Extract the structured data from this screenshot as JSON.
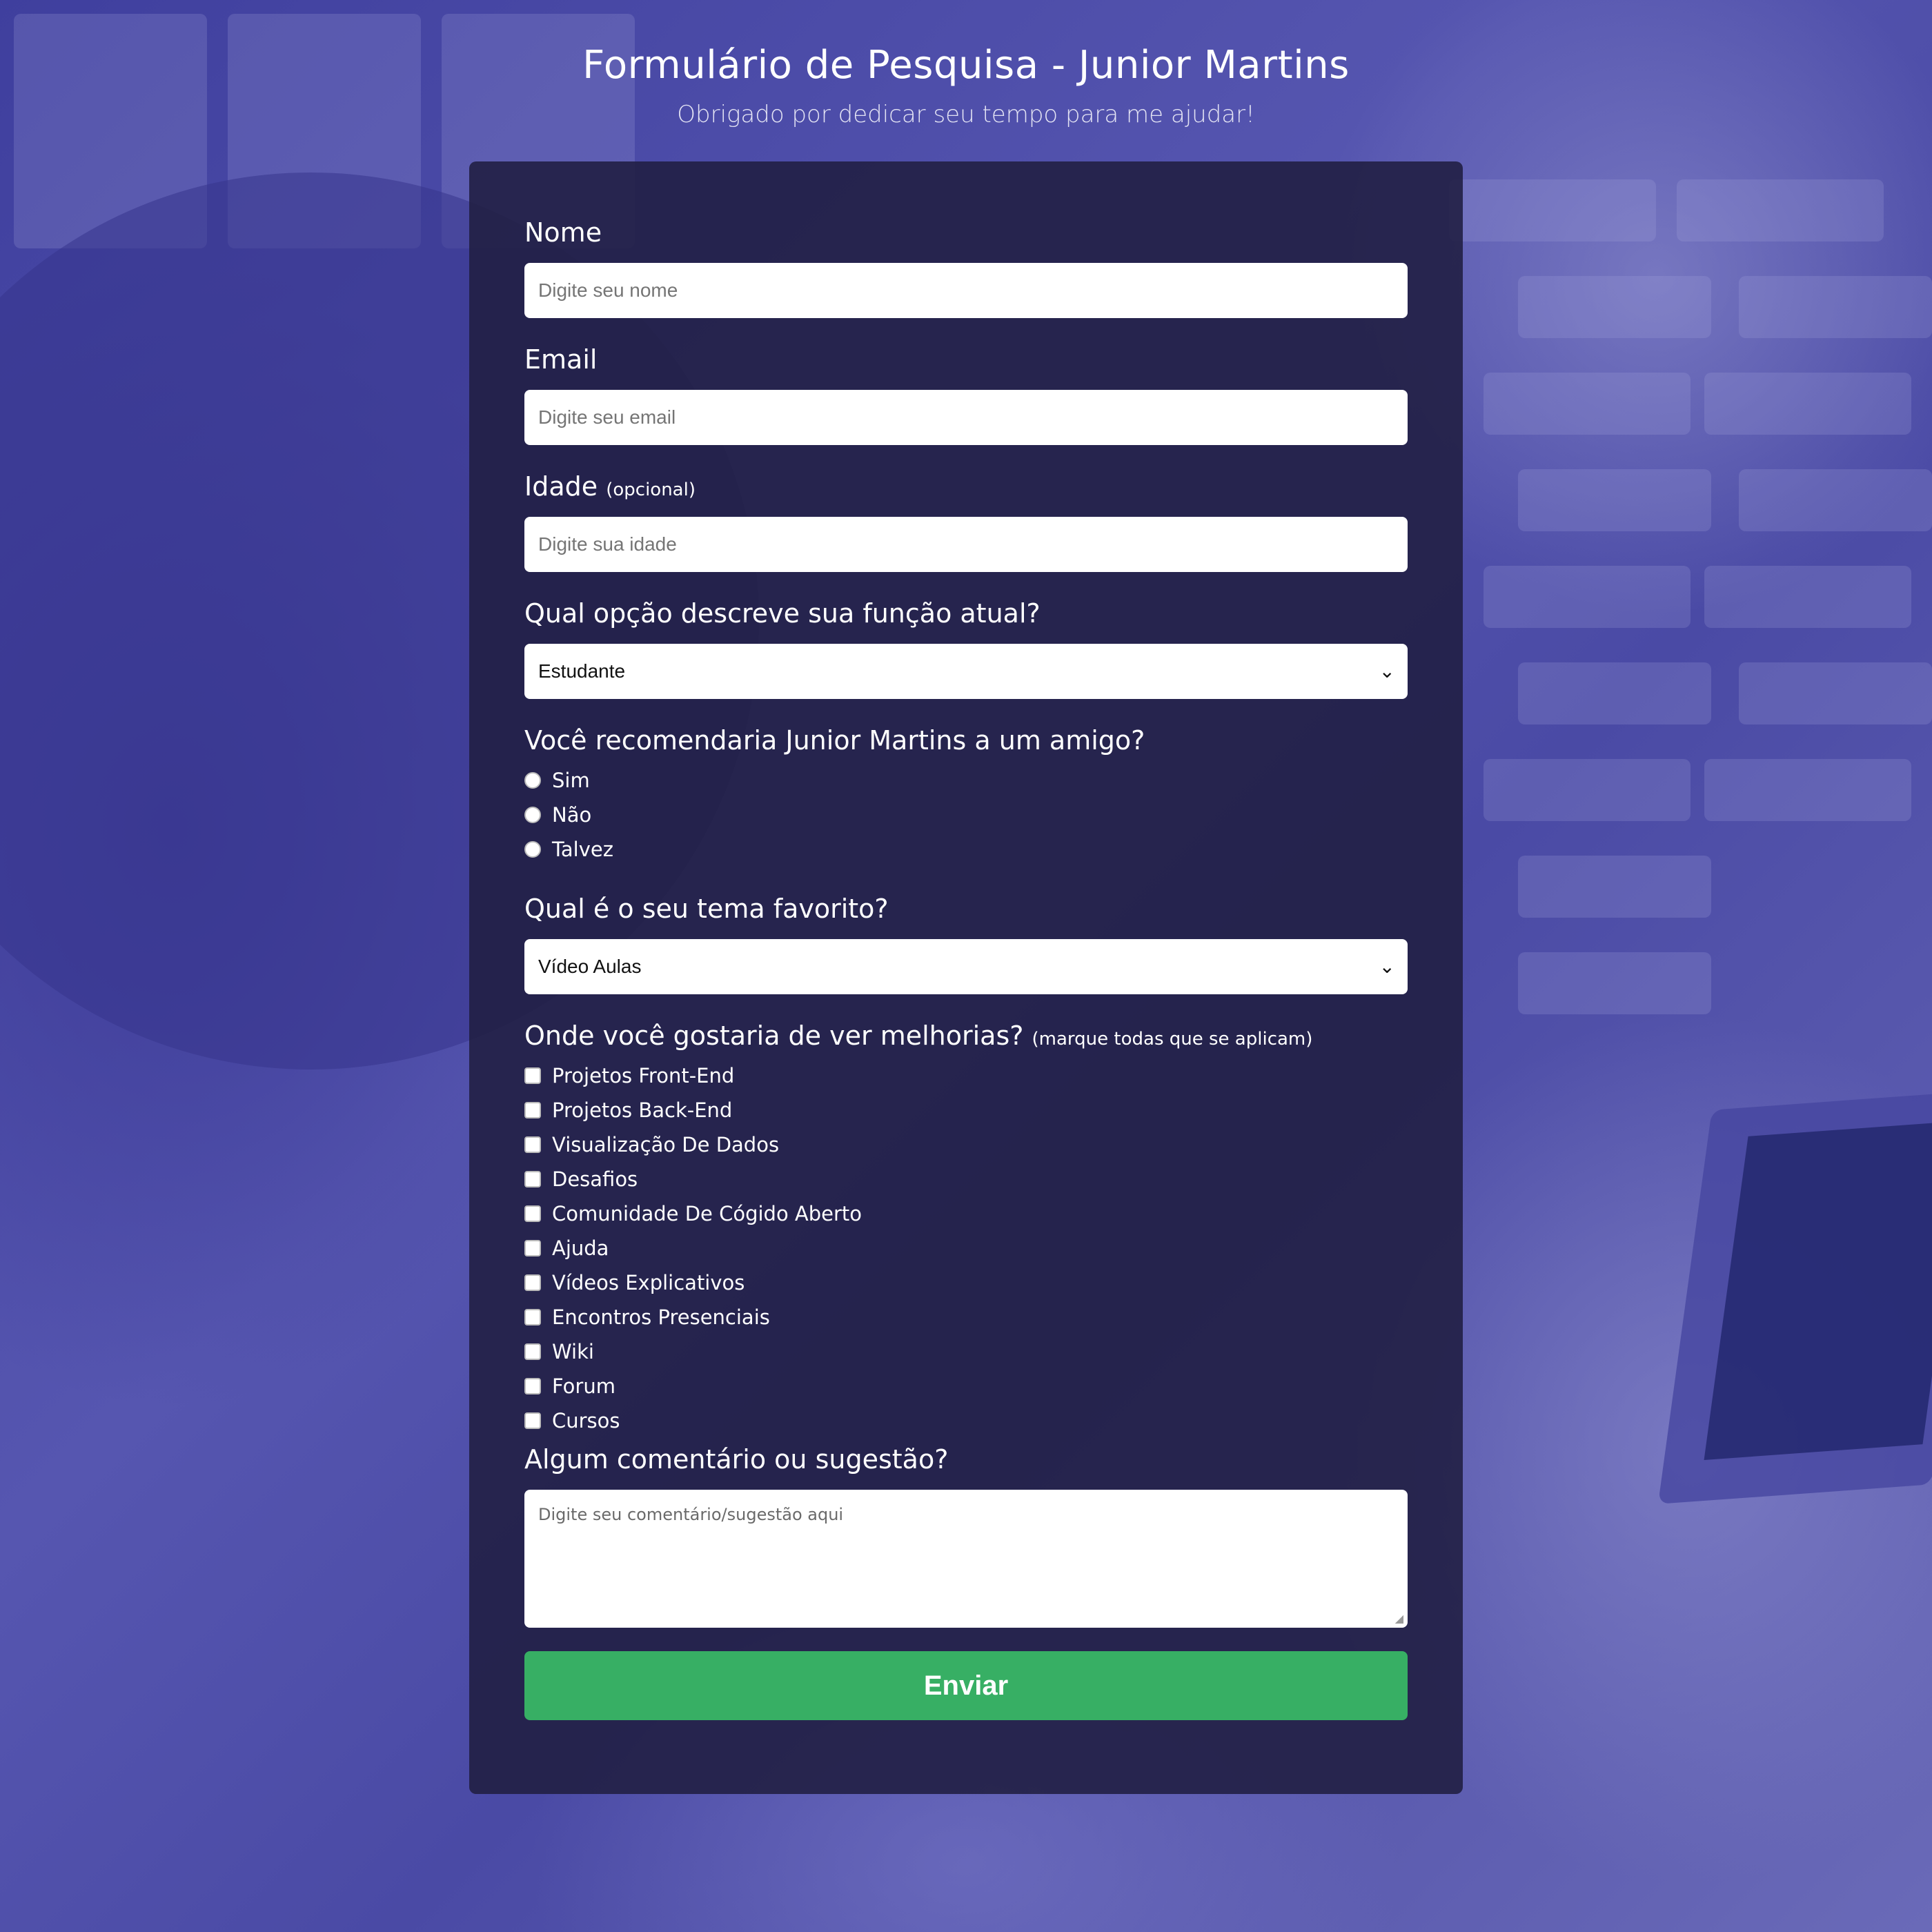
{
  "header": {
    "title": "Formulário de Pesquisa - Junior Martins",
    "subtitle": "Obrigado por dedicar seu tempo para me ajudar!"
  },
  "form": {
    "name": {
      "label": "Nome",
      "placeholder": "Digite seu nome"
    },
    "email": {
      "label": "Email",
      "placeholder": "Digite seu email"
    },
    "age": {
      "label": "Idade",
      "clue": "(opcional)",
      "placeholder": "Digite sua idade"
    },
    "role": {
      "label": "Qual opção descreve sua função atual?",
      "selected": "Estudante"
    },
    "recommend": {
      "label": "Você recomendaria Junior Martins a um amigo?",
      "options": [
        "Sim",
        "Não",
        "Talvez"
      ]
    },
    "favorite": {
      "label": "Qual é o seu tema favorito?",
      "selected": "Vídeo Aulas"
    },
    "improvements": {
      "label": "Onde você gostaria de ver melhorias?",
      "clue": "(marque todas que se aplicam)",
      "options": [
        "Projetos Front-End",
        "Projetos Back-End",
        "Visualização De Dados",
        "Desafios",
        "Comunidade De Cógido Aberto",
        "Ajuda",
        "Vídeos Explicativos",
        "Encontros Presenciais",
        "Wiki",
        "Forum",
        "Cursos"
      ]
    },
    "comments": {
      "label": "Algum comentário ou sugestão?",
      "placeholder": "Digite seu comentário/sugestão aqui"
    },
    "submit_label": "Enviar"
  },
  "icons": {
    "select_arrow": "chevron-down-icon"
  },
  "colors": {
    "submit": "#37af64",
    "card": "#211f44",
    "background": "#4b4da6"
  }
}
